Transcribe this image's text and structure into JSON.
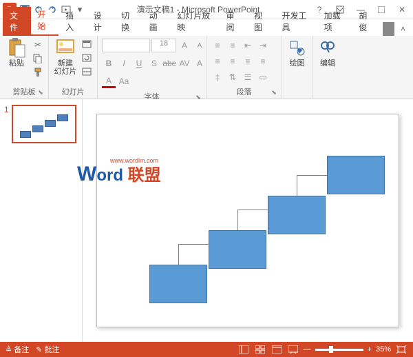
{
  "titlebar": {
    "app_icon": "P",
    "doc_title": "演示文稿1 - Microsoft PowerPoint"
  },
  "tabs": {
    "file": "文件",
    "home": "开始",
    "insert": "插入",
    "design": "设计",
    "transitions": "切换",
    "animations": "动画",
    "slideshow": "幻灯片放映",
    "review": "审阅",
    "view": "视图",
    "developer": "开发工具",
    "addins": "加载项",
    "user": "胡俊"
  },
  "ribbon": {
    "clipboard": {
      "paste": "粘贴",
      "label": "剪贴板"
    },
    "slides": {
      "new_slide": "新建\n幻灯片",
      "label": "幻灯片"
    },
    "font": {
      "size": "18",
      "label": "字体"
    },
    "paragraph": {
      "label": "段落"
    },
    "drawing": {
      "btn": "绘图",
      "label": ""
    },
    "editing": {
      "btn": "编辑",
      "label": ""
    }
  },
  "thumbnail": {
    "number": "1"
  },
  "watermark": {
    "w": "W",
    "ord": "ord",
    "cn": "联盟",
    "url": "www.wordlm.com"
  },
  "statusbar": {
    "notes": "备注",
    "comments": "批注",
    "zoom": "35%"
  },
  "chart_data": {
    "type": "diagram",
    "description": "Staircase of 4 rectangles connected by elbow connectors, ascending left-to-right",
    "boxes": 4,
    "box_fill": "#5b9bd5",
    "box_border": "#41719c"
  }
}
